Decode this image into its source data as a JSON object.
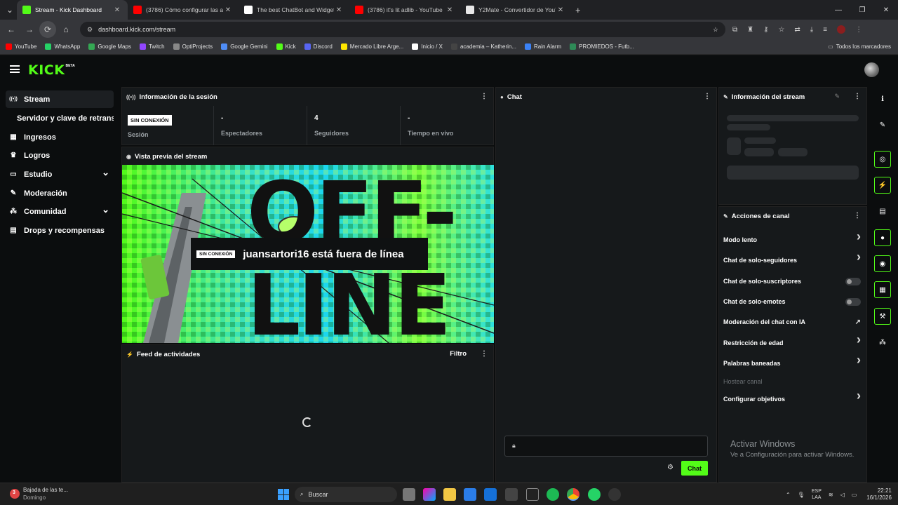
{
  "browser": {
    "tabs": [
      {
        "title": "Stream - Kick Dashboard",
        "active": true,
        "favicon_color": "#53fc18"
      },
      {
        "title": "(3786) Cómo configurar las aler",
        "active": false,
        "favicon_color": "#ff0000"
      },
      {
        "title": "The best ChatBot and Widgets",
        "active": false,
        "favicon_color": "#ffffff"
      },
      {
        "title": "(3786) it's lit adlib - YouTube",
        "active": false,
        "favicon_color": "#ff0000"
      },
      {
        "title": "Y2Mate - Convertidor de YouTu",
        "active": false,
        "favicon_color": "#e8e8e8"
      }
    ],
    "url": "dashboard.kick.com/stream",
    "bookmarks": [
      {
        "label": "YouTube",
        "color": "#ff0000"
      },
      {
        "label": "WhatsApp",
        "color": "#25d366"
      },
      {
        "label": "Google Maps",
        "color": "#34a853"
      },
      {
        "label": "Twitch",
        "color": "#9146ff"
      },
      {
        "label": "OptiProjects",
        "color": "#888888"
      },
      {
        "label": "Google Gemini",
        "color": "#4f8df7"
      },
      {
        "label": "Kick",
        "color": "#53fc18"
      },
      {
        "label": "Discord",
        "color": "#5865f2"
      },
      {
        "label": "Mercado Libre Arge...",
        "color": "#ffe600"
      },
      {
        "label": "Inicio / X",
        "color": "#ffffff"
      },
      {
        "label": "academia – Katherin...",
        "color": "#444444"
      },
      {
        "label": "Rain Alarm",
        "color": "#3b82f6"
      },
      {
        "label": "PROMIEDOS - Futb...",
        "color": "#2e8b57"
      }
    ],
    "all_bookmarks": "Todos los marcadores"
  },
  "app": {
    "logo": "KICK",
    "logo_badge": "BETA",
    "accent": "#53fc18"
  },
  "sidebar": {
    "items": [
      {
        "label": "Stream",
        "icon": "stream-icon"
      },
      {
        "label": "Servidor y clave de retransm",
        "icon": ""
      },
      {
        "label": "Ingresos",
        "icon": "income-icon"
      },
      {
        "label": "Logros",
        "icon": "trophy-icon"
      },
      {
        "label": "Estudio",
        "icon": "studio-icon",
        "chevron": true
      },
      {
        "label": "Moderación",
        "icon": "wrench-icon"
      },
      {
        "label": "Comunidad",
        "icon": "community-icon",
        "chevron": true
      },
      {
        "label": "Drops y recompensas",
        "icon": "drops-icon"
      }
    ]
  },
  "session": {
    "title": "Información de la sesión",
    "status_badge": "SIN CONEXIÓN",
    "stats": [
      {
        "value": "",
        "label": "Sesión"
      },
      {
        "value": "-",
        "label": "Espectadores"
      },
      {
        "value": "4",
        "label": "Seguidores"
      },
      {
        "value": "-",
        "label": "Tiempo en vivo"
      }
    ]
  },
  "preview": {
    "title": "Vista previa del stream",
    "offline_badge": "SIN CONEXIÓN",
    "offline_message": "juansartori16 está fuera de línea",
    "art_word_top": "OFF-",
    "art_word_bottom": "LINE"
  },
  "feed": {
    "title": "Feed de actividades",
    "filter": "Filtro"
  },
  "chat": {
    "title": "Chat",
    "send_label": "Chat"
  },
  "stream_info": {
    "title": "Información del stream"
  },
  "channel_actions": {
    "title": "Acciones de canal",
    "items": [
      {
        "label": "Modo lento",
        "control": "arrow"
      },
      {
        "label": "Chat de solo-seguidores",
        "control": "arrow"
      },
      {
        "label": "Chat de solo-suscriptores",
        "control": "toggle"
      },
      {
        "label": "Chat de solo-emotes",
        "control": "toggle"
      },
      {
        "label": "Moderación del chat con IA",
        "control": "external"
      },
      {
        "label": "Restricción de edad",
        "control": "arrow"
      },
      {
        "label": "Palabras baneadas",
        "control": "arrow"
      },
      {
        "label": "Hostear canal",
        "control": "none",
        "disabled": true
      },
      {
        "label": "Configurar objetivos",
        "control": "arrow"
      }
    ]
  },
  "watermark": {
    "line1": "Activar Windows",
    "line2": "Ve a Configuración para activar Windows."
  },
  "taskbar": {
    "notification_title": "Bajada de las te...",
    "notification_sub": "Domingo",
    "notification_count": "3",
    "search": "Buscar",
    "lang1": "ESP",
    "lang2": "LAA",
    "time": "22:21",
    "date": "16/1/2026"
  }
}
